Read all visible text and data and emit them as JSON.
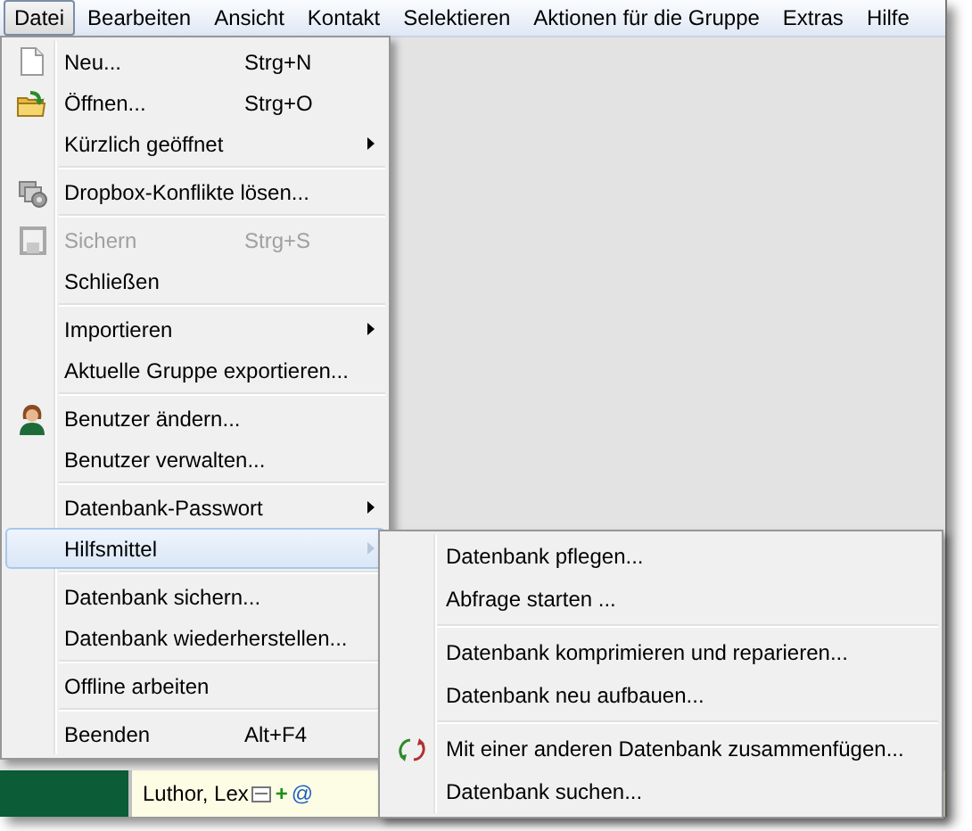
{
  "menubar": [
    {
      "label": "Datei",
      "selected": true
    },
    {
      "label": "Bearbeiten",
      "selected": false
    },
    {
      "label": "Ansicht",
      "selected": false
    },
    {
      "label": "Kontakt",
      "selected": false
    },
    {
      "label": "Selektieren",
      "selected": false
    },
    {
      "label": "Aktionen für die Gruppe",
      "selected": false
    },
    {
      "label": "Extras",
      "selected": false
    },
    {
      "label": "Hilfe",
      "selected": false
    }
  ],
  "file_menu": [
    {
      "kind": "item",
      "label": "Neu...",
      "shortcut": "Strg+N",
      "submenu": false,
      "disabled": false,
      "selected": false
    },
    {
      "kind": "item",
      "label": "Öffnen...",
      "shortcut": "Strg+O",
      "submenu": false,
      "disabled": false,
      "selected": false
    },
    {
      "kind": "item",
      "label": "Kürzlich geöffnet",
      "submenu": true,
      "disabled": false,
      "selected": false
    },
    {
      "kind": "separator"
    },
    {
      "kind": "item",
      "label": "Dropbox-Konflikte lösen...",
      "submenu": false,
      "disabled": false,
      "selected": false
    },
    {
      "kind": "separator"
    },
    {
      "kind": "item",
      "label": "Sichern",
      "shortcut": "Strg+S",
      "submenu": false,
      "disabled": true,
      "selected": false
    },
    {
      "kind": "item",
      "label": "Schließen",
      "submenu": false,
      "disabled": false,
      "selected": false
    },
    {
      "kind": "separator"
    },
    {
      "kind": "item",
      "label": "Importieren",
      "submenu": true,
      "disabled": false,
      "selected": false
    },
    {
      "kind": "item",
      "label": "Aktuelle Gruppe exportieren...",
      "submenu": false,
      "disabled": false,
      "selected": false
    },
    {
      "kind": "separator"
    },
    {
      "kind": "item",
      "label": "Benutzer ändern...",
      "submenu": false,
      "disabled": false,
      "selected": false
    },
    {
      "kind": "item",
      "label": "Benutzer verwalten...",
      "submenu": false,
      "disabled": false,
      "selected": false
    },
    {
      "kind": "separator"
    },
    {
      "kind": "item",
      "label": "Datenbank-Passwort",
      "submenu": true,
      "disabled": false,
      "selected": false
    },
    {
      "kind": "item",
      "label": "Hilfsmittel",
      "submenu": true,
      "disabled": false,
      "selected": true
    },
    {
      "kind": "separator"
    },
    {
      "kind": "item",
      "label": "Datenbank sichern...",
      "submenu": false,
      "disabled": false,
      "selected": false
    },
    {
      "kind": "item",
      "label": "Datenbank wiederherstellen...",
      "submenu": false,
      "disabled": false,
      "selected": false
    },
    {
      "kind": "separator"
    },
    {
      "kind": "item",
      "label": "Offline arbeiten",
      "submenu": false,
      "disabled": false,
      "selected": false
    },
    {
      "kind": "separator"
    },
    {
      "kind": "item",
      "label": "Beenden",
      "shortcut": "Alt+F4",
      "submenu": false,
      "disabled": false,
      "selected": false
    }
  ],
  "tools_submenu": [
    {
      "kind": "item",
      "label": "Datenbank pflegen...",
      "selected": false
    },
    {
      "kind": "item",
      "label": "Abfrage starten ...",
      "selected": false
    },
    {
      "kind": "separator"
    },
    {
      "kind": "item",
      "label": "Datenbank komprimieren und reparieren...",
      "selected": false
    },
    {
      "kind": "item",
      "label": "Datenbank neu aufbauen...",
      "selected": false
    },
    {
      "kind": "separator"
    },
    {
      "kind": "item",
      "label": "Mit einer anderen Datenbank zusammenfügen...",
      "selected": false
    },
    {
      "kind": "item",
      "label": "Datenbank suchen...",
      "selected": false
    }
  ],
  "contact": {
    "name": "Luthor, Lex",
    "markers": [
      "+",
      "@"
    ]
  }
}
